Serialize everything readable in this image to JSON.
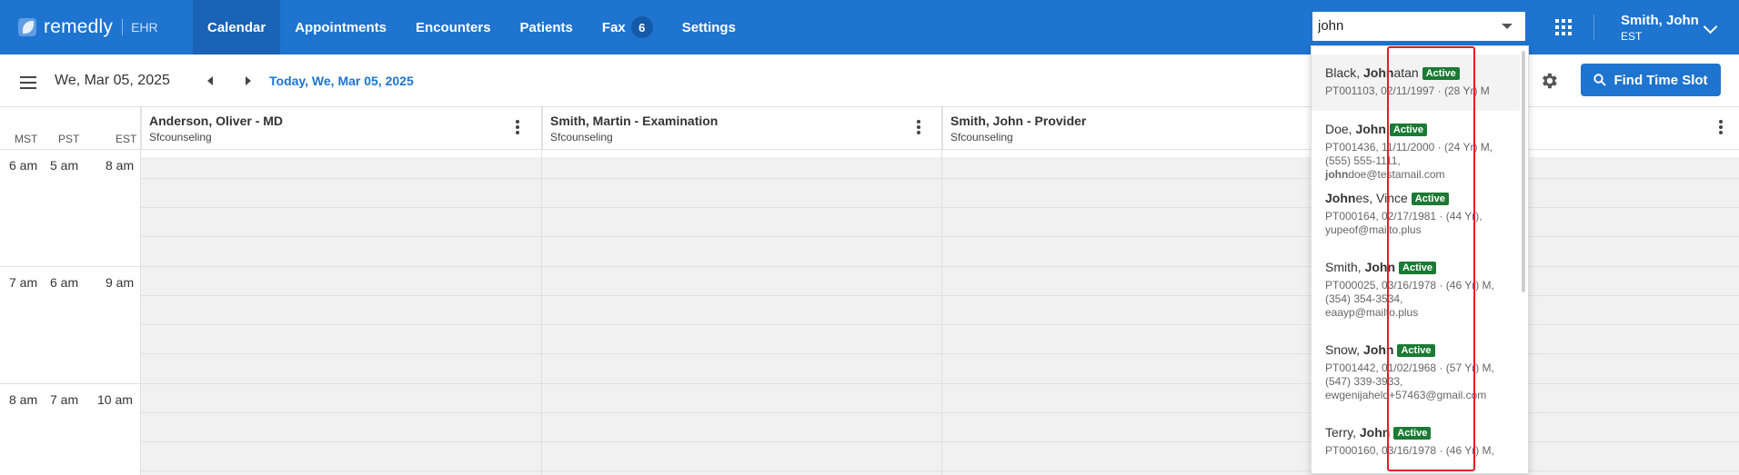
{
  "brand": {
    "name": "remedly",
    "product": "EHR"
  },
  "nav": [
    {
      "label": "Calendar",
      "active": true
    },
    {
      "label": "Appointments"
    },
    {
      "label": "Encounters"
    },
    {
      "label": "Patients"
    },
    {
      "label": "Fax",
      "badge": "6"
    },
    {
      "label": "Settings"
    }
  ],
  "search": {
    "value": "john"
  },
  "user": {
    "name": "Smith, John",
    "timezone": "EST"
  },
  "toolbar": {
    "date": "We, Mar 05, 2025",
    "today_link": "Today, We, Mar 05, 2025",
    "find_button": "Find Time Slot"
  },
  "timezones": [
    "MST",
    "PST",
    "EST"
  ],
  "columns": [
    {
      "name": "Anderson, Oliver - MD",
      "location": "Sfcounseling"
    },
    {
      "name": "Smith, Martin - Examination",
      "location": "Sfcounseling"
    },
    {
      "name": "Smith, John - Provider",
      "location": "Sfcounseling"
    }
  ],
  "time_rows": [
    {
      "mst": "6 am",
      "pst": "5 am",
      "est": "8 am"
    },
    {
      "mst": "7 am",
      "pst": "6 am",
      "est": "9 am"
    },
    {
      "mst": "8 am",
      "pst": "7 am",
      "est": "10 am"
    }
  ],
  "results": [
    {
      "name_pre": "Black, ",
      "name_bold": "John",
      "name_post": "atan",
      "status": "Active",
      "lines": [
        "PT001103, 02/11/1997 · (28 Yr) M"
      ]
    },
    {
      "name_pre": "Doe, ",
      "name_bold": "John",
      "name_post": "",
      "status": "Active",
      "lines": [
        "PT001436, 11/11/2000 · (24 Yr) M,",
        "(555) 555-1111,"
      ],
      "email_bold": "john",
      "email_rest": "doe@testamail.com"
    },
    {
      "name_pre": "",
      "name_bold": "John",
      "name_post": "es, Vince",
      "status": "Active",
      "lines": [
        "PT000164, 02/17/1981 · (44 Yr),",
        "yupeof@mailto.plus"
      ]
    },
    {
      "name_pre": "Smith, ",
      "name_bold": "John",
      "name_post": "",
      "status": "Active",
      "lines": [
        "PT000025, 03/16/1978 · (46 Yr) M,",
        "(354) 354-3534,",
        "eaayp@mailto.plus"
      ]
    },
    {
      "name_pre": "Snow, ",
      "name_bold": "John",
      "name_post": "",
      "status": "Active",
      "lines": [
        "PT001442, 01/02/1968 · (57 Yr) M,",
        "(547) 339-3933,",
        "ewgenijaheld+57463@gmail.com"
      ]
    },
    {
      "name_pre": "Terry, ",
      "name_bold": "John",
      "name_post": "",
      "status": "Active",
      "lines": [
        "PT000160, 03/16/1978 · (46 Yr) M,"
      ]
    }
  ],
  "colors": {
    "primary": "#1e74cf",
    "active_status": "#1b7a33",
    "highlight_box": "#e02020"
  }
}
